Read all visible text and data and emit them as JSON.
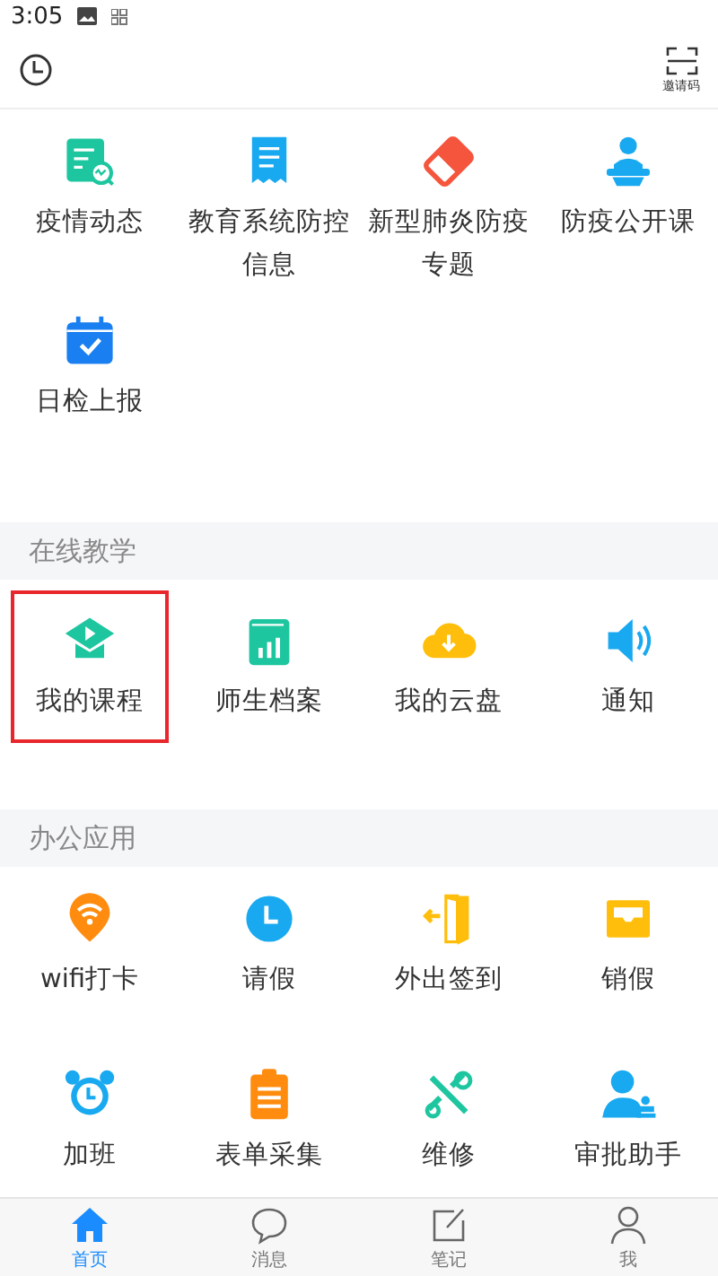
{
  "status_bar": {
    "time": "3:05"
  },
  "header": {
    "scan_label": "邀请码"
  },
  "sections": [
    {
      "items": [
        {
          "label": "疫情动态",
          "highlighted": false
        },
        {
          "label": "教育系统防控信息",
          "highlighted": false
        },
        {
          "label": "新型肺炎防疫专题",
          "highlighted": false
        },
        {
          "label": "防疫公开课",
          "highlighted": false
        },
        {
          "label": "日检上报",
          "highlighted": false
        }
      ]
    },
    {
      "title": "在线教学",
      "items": [
        {
          "label": "我的课程",
          "highlighted": true
        },
        {
          "label": "师生档案",
          "highlighted": false
        },
        {
          "label": "我的云盘",
          "highlighted": false
        },
        {
          "label": "通知",
          "highlighted": false
        }
      ]
    },
    {
      "title": "办公应用",
      "items": [
        {
          "label": "wifi打卡",
          "highlighted": false
        },
        {
          "label": "请假",
          "highlighted": false
        },
        {
          "label": "外出签到",
          "highlighted": false
        },
        {
          "label": "销假",
          "highlighted": false
        },
        {
          "label": "加班",
          "highlighted": false
        },
        {
          "label": "表单采集",
          "highlighted": false
        },
        {
          "label": "维修",
          "highlighted": false
        },
        {
          "label": "审批助手",
          "highlighted": false
        }
      ]
    }
  ],
  "tab_bar": [
    {
      "label": "首页",
      "selected": true
    },
    {
      "label": "消息",
      "selected": false
    },
    {
      "label": "笔记",
      "selected": false
    },
    {
      "label": "我",
      "selected": false
    }
  ]
}
